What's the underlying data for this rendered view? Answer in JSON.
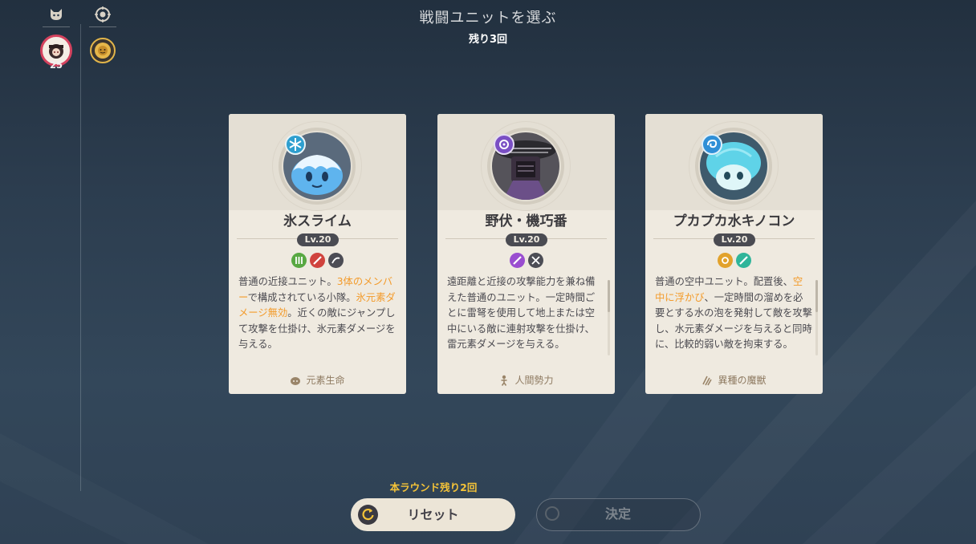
{
  "header": {
    "title": "戦闘ユニットを選ぶ",
    "remaining": "残り3回"
  },
  "sidebar": {
    "top_icons": [
      {
        "icon": "cat-head-icon"
      },
      {
        "icon": "compass-icon"
      }
    ],
    "player_badge": {
      "icon": "player-avatar",
      "level": "25"
    },
    "lion_badge": {
      "icon": "lion-emblem-icon"
    }
  },
  "cards": [
    {
      "name": "氷スライム",
      "level": "Lv.20",
      "traits": [
        "melee-icon",
        "ice-damage-icon",
        "jump-icon"
      ],
      "description_parts": [
        {
          "text": "普通の近接ユニット。",
          "highlight": false
        },
        {
          "text": "3体のメンバー",
          "highlight": true
        },
        {
          "text": "で構成されている小隊。",
          "highlight": false
        },
        {
          "text": "氷元素ダメージ無効",
          "highlight": true
        },
        {
          "text": "。近くの敵にジャンプして攻撃を仕掛け、氷元素ダメージを与える。",
          "highlight": false
        }
      ],
      "category": "元素生命",
      "category_icon": "slime-icon"
    },
    {
      "name": "野伏・機巧番",
      "level": "Lv.20",
      "traits": [
        "electro-damage-icon",
        "ranged-melee-icon"
      ],
      "description_parts": [
        {
          "text": "遠距離と近接の攻撃能力を兼ね備えた普通のユニット。一定時間ごとに雷弩を使用して地上または空中にいる敵に連射攻撃を仕掛け、雷元素ダメージを与える。",
          "highlight": false
        }
      ],
      "category": "人間勢力",
      "category_icon": "human-icon"
    },
    {
      "name": "プカプカ水キノコン",
      "level": "Lv.20",
      "traits": [
        "airborne-icon",
        "hydro-damage-icon"
      ],
      "description_parts": [
        {
          "text": "普通の空中ユニット。配置後、",
          "highlight": false
        },
        {
          "text": "空中に浮かび",
          "highlight": true
        },
        {
          "text": "、一定時間の溜めを必要とする水の泡を発射して敵を攻撃し、水元素ダメージを与えると同時に、比較的弱い敵を拘束する。",
          "highlight": false
        }
      ],
      "category": "異種の魔獣",
      "category_icon": "claw-icon"
    }
  ],
  "footer": {
    "round_hint": "本ラウンド残り2回",
    "reset_label": "リセット",
    "confirm_label": "決定"
  },
  "colors": {
    "highlight": "#f39b2b",
    "hint_yellow": "#f4c338",
    "card_bg": "#efeae0"
  }
}
